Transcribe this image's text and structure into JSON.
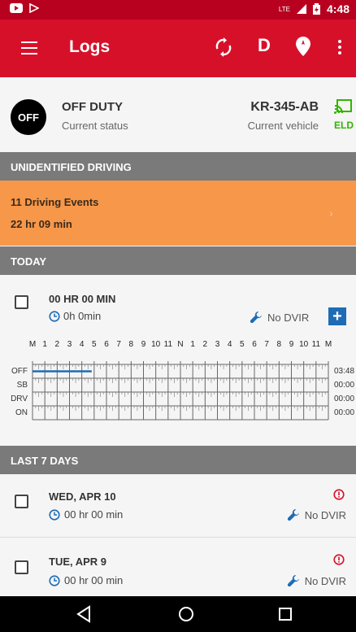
{
  "statusbar": {
    "time": "4:48",
    "network": "LTE"
  },
  "appbar": {
    "title": "Logs",
    "d_label": "D"
  },
  "status": {
    "badge": "OFF",
    "title": "OFF DUTY",
    "subtitle": "Current status",
    "vehicle": "KR-345-AB",
    "vehicle_sub": "Current vehicle",
    "eld": "ELD"
  },
  "unidentified": {
    "header": "UNIDENTIFIED DRIVING",
    "events": "11 Driving Events",
    "duration": "22 hr  09 min"
  },
  "today": {
    "header": "TODAY",
    "hours": "00 HR  00 MIN",
    "clock_text": "0h 0min",
    "dvir": "No DVIR",
    "plus": "+",
    "grid": {
      "hour_labels": [
        "M",
        "1",
        "2",
        "3",
        "4",
        "5",
        "6",
        "7",
        "8",
        "9",
        "10",
        "11",
        "N",
        "1",
        "2",
        "3",
        "4",
        "5",
        "6",
        "7",
        "8",
        "9",
        "10",
        "11",
        "M"
      ],
      "rows": [
        "OFF",
        "SB",
        "DRV",
        "ON"
      ],
      "totals": [
        "03:48",
        "00:00",
        "00:00",
        "00:00"
      ],
      "off_until_hour": 4.8
    }
  },
  "last7": {
    "header": "LAST 7 DAYS",
    "items": [
      {
        "date": "WED, APR 10",
        "duration": "00 hr  00 min",
        "dvir": "No DVIR"
      },
      {
        "date": "TUE, APR 9",
        "duration": "00 hr  00 min",
        "dvir": "No DVIR"
      }
    ]
  },
  "colors": {
    "appbar": "#d7102a",
    "statusbar": "#b8001f",
    "orange": "#f7974a",
    "section": "#7a7a7a",
    "blue": "#1e6cb5",
    "eld_green": "#33b400"
  }
}
